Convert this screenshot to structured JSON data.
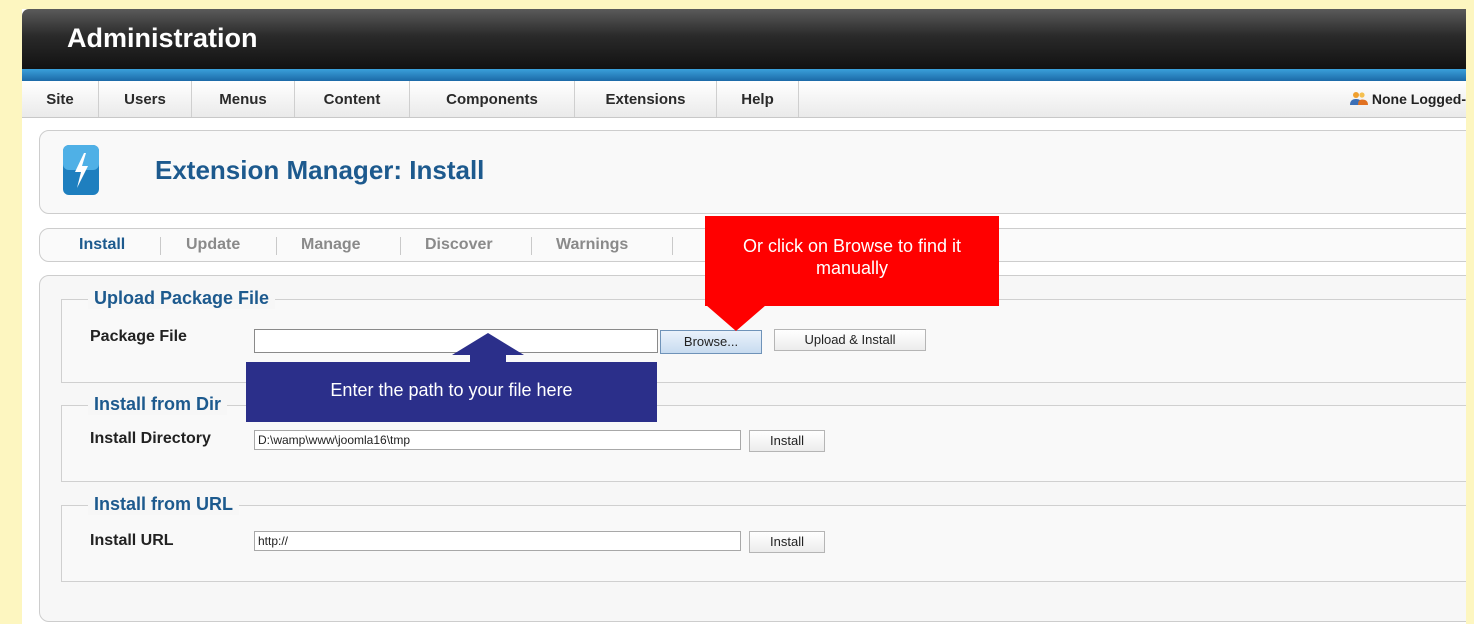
{
  "header": {
    "title": "Administration"
  },
  "menubar": {
    "items": [
      "Site",
      "Users",
      "Menus",
      "Content",
      "Components",
      "Extensions",
      "Help"
    ],
    "user_status": "None Logged-"
  },
  "page": {
    "title": "Extension Manager: Install"
  },
  "submenu": {
    "items": [
      "Install",
      "Update",
      "Manage",
      "Discover",
      "Warnings"
    ],
    "active": "Install"
  },
  "upload": {
    "legend": "Upload Package File",
    "label": "Package File",
    "value": "",
    "browse_label": "Browse...",
    "submit_label": "Upload & Install"
  },
  "directory": {
    "legend": "Install from Dir",
    "label": "Install Directory",
    "value": "D:\\wamp\\www\\joomla16\\tmp",
    "submit_label": "Install"
  },
  "url": {
    "legend": "Install from URL",
    "label": "Install URL",
    "value": "http://",
    "submit_label": "Install"
  },
  "callouts": {
    "browse_hint": "Or click on Browse to find it manually",
    "path_hint": "Enter the path to your file here",
    "browse_color": "#ff0000",
    "path_color": "#2b2f8a"
  }
}
